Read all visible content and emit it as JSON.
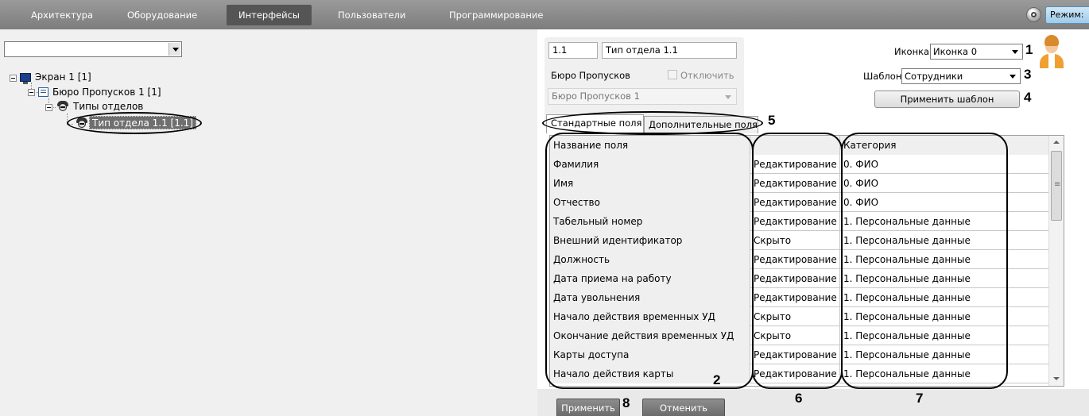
{
  "menu": {
    "items": [
      {
        "label": "Архитектура"
      },
      {
        "label": "Оборудование"
      },
      {
        "label": "Интерфейсы"
      },
      {
        "label": "Пользователи"
      },
      {
        "label": "Программирование"
      }
    ],
    "mode_label": "Режим:"
  },
  "tree": {
    "combo_value": "",
    "nodes": [
      {
        "label": "Экран 1 [1]"
      },
      {
        "label": "Бюро Пропусков 1 [1]"
      },
      {
        "label": "Типы отделов"
      },
      {
        "label": "Тип отдела 1.1 [1.1]"
      }
    ]
  },
  "object": {
    "id": "1.1",
    "name": "Тип отдела 1.1",
    "parent_label": "Бюро Пропусков",
    "disable_label": "Отключить",
    "parent_value": "Бюро Пропусков 1",
    "icon_label": "Иконка",
    "icon_value": "Иконка 0",
    "template_label": "Шаблон",
    "template_value": "Сотрудники",
    "apply_template_label": "Применить шаблон"
  },
  "tabs": [
    {
      "label": "Стандартные поля"
    },
    {
      "label": "Дополнительные поля"
    }
  ],
  "grid": {
    "header": {
      "field": "Название поля",
      "mode": "",
      "category": "Категория"
    },
    "rows": [
      {
        "field": "Фамилия",
        "mode": "Редактирование",
        "category": "0. ФИО"
      },
      {
        "field": "Имя",
        "mode": "Редактирование",
        "category": "0. ФИО"
      },
      {
        "field": "Отчество",
        "mode": "Редактирование",
        "category": "0. ФИО"
      },
      {
        "field": "Табельный номер",
        "mode": "Редактирование",
        "category": "1. Персональные данные"
      },
      {
        "field": "Внешний идентификатор",
        "mode": "Скрыто",
        "category": "1. Персональные данные"
      },
      {
        "field": "Должность",
        "mode": "Редактирование",
        "category": "1. Персональные данные"
      },
      {
        "field": "Дата приема на работу",
        "mode": "Редактирование",
        "category": "1. Персональные данные"
      },
      {
        "field": "Дата увольнения",
        "mode": "Редактирование",
        "category": "1. Персональные данные"
      },
      {
        "field": "Начало действия временных УД",
        "mode": "Скрыто",
        "category": "1. Персональные данные"
      },
      {
        "field": "Окончание действия временных УД",
        "mode": "Скрыто",
        "category": "1. Персональные данные"
      },
      {
        "field": "Карты доступа",
        "mode": "Редактирование",
        "category": "1. Персональные данные"
      },
      {
        "field": "Начало действия карты",
        "mode": "Редактирование",
        "category": "1. Персональные данные"
      }
    ]
  },
  "footer": {
    "apply_label": "Применить",
    "cancel_label": "Отменить"
  },
  "annotations": [
    "1",
    "2",
    "3",
    "4",
    "5",
    "6",
    "7",
    "8"
  ]
}
